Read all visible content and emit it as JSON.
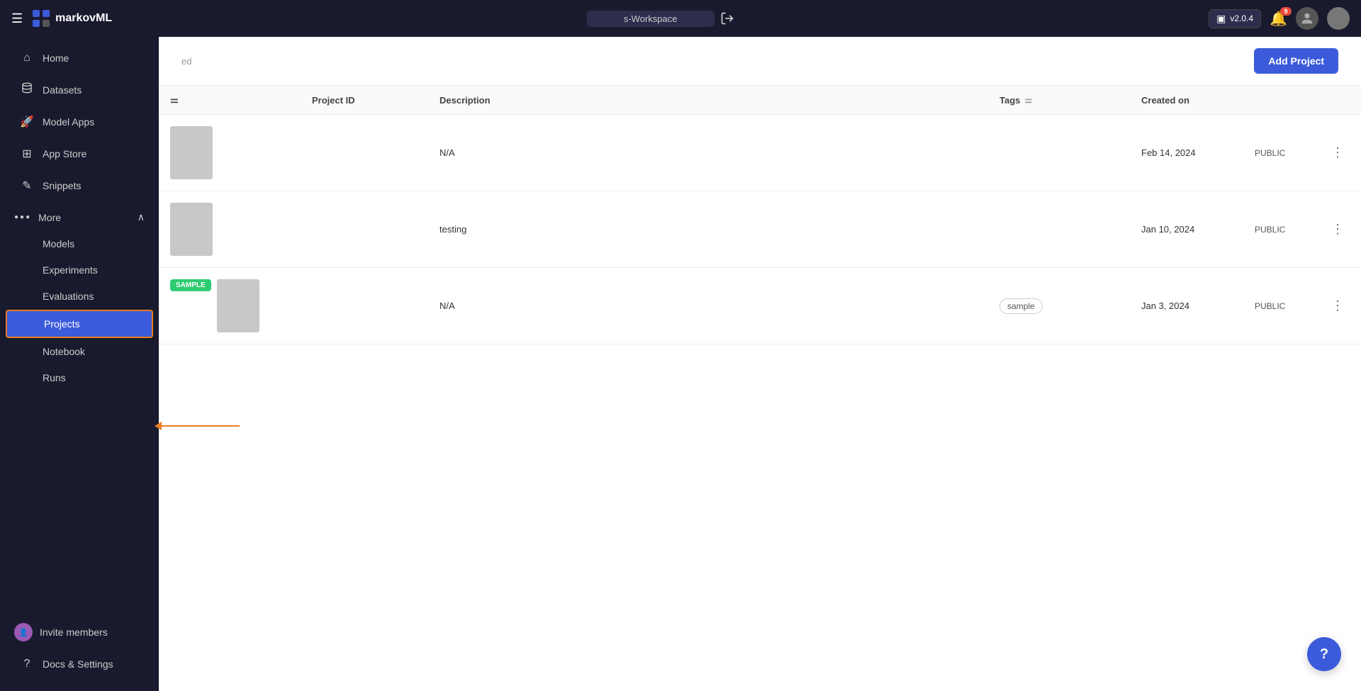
{
  "topbar": {
    "menu_icon": "☰",
    "logo_text": "markovML",
    "workspace_label": "s-Workspace",
    "exit_icon": "⎋",
    "version_label": "v2.0.4",
    "version_icon": "▣",
    "notifications_count": "9",
    "add_project_label": "Add Project"
  },
  "sidebar": {
    "nav_items": [
      {
        "id": "home",
        "label": "Home",
        "icon": "⌂"
      },
      {
        "id": "datasets",
        "label": "Datasets",
        "icon": "🗃"
      },
      {
        "id": "model-apps",
        "label": "Model Apps",
        "icon": "🚀"
      },
      {
        "id": "app-store",
        "label": "App Store",
        "icon": "⊞"
      },
      {
        "id": "snippets",
        "label": "Snippets",
        "icon": "✎"
      }
    ],
    "more_label": "More",
    "more_icon": "···",
    "more_expanded": true,
    "sub_items": [
      {
        "id": "models",
        "label": "Models",
        "active": false
      },
      {
        "id": "experiments",
        "label": "Experiments",
        "active": false
      },
      {
        "id": "evaluations",
        "label": "Evaluations",
        "active": false
      },
      {
        "id": "projects",
        "label": "Projects",
        "active": true
      },
      {
        "id": "notebook",
        "label": "Notebook",
        "active": false
      },
      {
        "id": "runs",
        "label": "Runs",
        "active": false
      }
    ],
    "invite_label": "Invite members",
    "docs_label": "Docs & Settings"
  },
  "table": {
    "columns": [
      {
        "id": "name",
        "label": ""
      },
      {
        "id": "project_id",
        "label": "Project ID",
        "filterable": true
      },
      {
        "id": "description",
        "label": "Description"
      },
      {
        "id": "tags",
        "label": "Tags",
        "filterable": true
      },
      {
        "id": "created_on",
        "label": "Created on"
      },
      {
        "id": "visibility",
        "label": ""
      },
      {
        "id": "actions",
        "label": ""
      }
    ],
    "rows": [
      {
        "id": "row1",
        "thumbnail": true,
        "name_badge": null,
        "project_id": "",
        "description": "N/A",
        "tags": [],
        "created_on": "Feb 14, 2024",
        "visibility": "PUBLIC"
      },
      {
        "id": "row2",
        "thumbnail": true,
        "name_badge": null,
        "project_id": "",
        "description": "testing",
        "tags": [],
        "created_on": "Jan 10, 2024",
        "visibility": "PUBLIC"
      },
      {
        "id": "row3",
        "thumbnail": true,
        "name_badge": "SAMPLE",
        "project_id": "",
        "description": "N/A",
        "tags": [
          "sample"
        ],
        "created_on": "Jan 3, 2024",
        "visibility": "PUBLIC"
      }
    ]
  },
  "help_button": "?"
}
